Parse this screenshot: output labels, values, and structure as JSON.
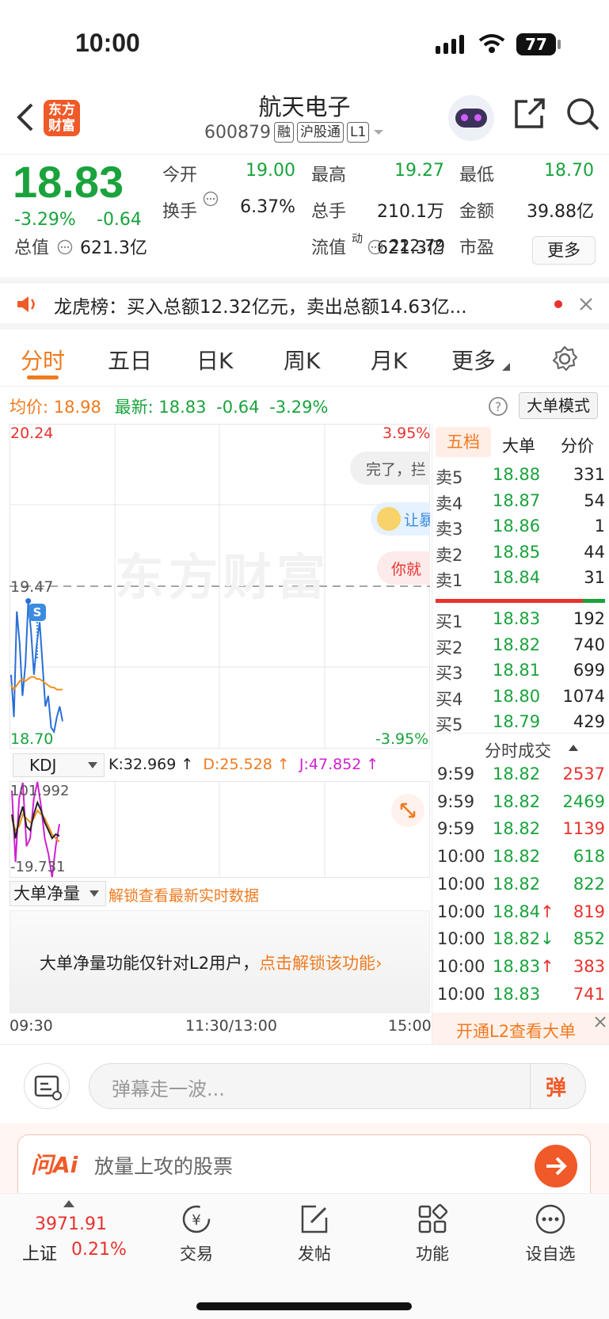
{
  "status": {
    "time": "10:00",
    "battery": "77"
  },
  "header": {
    "brand": "东方财富",
    "title": "航天电子",
    "code": "600879",
    "tags": [
      "融",
      "沪股通",
      "L1"
    ]
  },
  "quote": {
    "price": "18.83",
    "pct": "-3.29%",
    "chg": "-0.64",
    "fields": [
      {
        "label": "今开",
        "value": "19.00",
        "color": "green"
      },
      {
        "label": "最高",
        "value": "19.27",
        "color": "green"
      },
      {
        "label": "最低",
        "value": "18.70",
        "color": "green"
      },
      {
        "label": "换手",
        "value": "6.37%",
        "color": "dark"
      },
      {
        "label": "总手",
        "value": "210.1万",
        "color": "dark"
      },
      {
        "label": "金额",
        "value": "39.88亿",
        "color": "dark"
      },
      {
        "label": "总值",
        "value": "621.3亿",
        "color": "dark"
      },
      {
        "label": "流值",
        "value": "621.3亿",
        "color": "dark"
      },
      {
        "label": "市盈",
        "value": "222.79",
        "color": "dark"
      }
    ],
    "pe_sup": "动",
    "more": "更多"
  },
  "banner": {
    "text": "龙虎榜：买入总额12.32亿元，卖出总额14.63亿..."
  },
  "tabs": [
    "分时",
    "五日",
    "日K",
    "周K",
    "月K",
    "更多"
  ],
  "chart": {
    "avg_label": "均价:",
    "avg": "18.98",
    "latest_label": "最新:",
    "latest": "18.83",
    "chg": "-0.64",
    "pct": "-3.29%",
    "mode": "大单模式",
    "y_max": "20.24",
    "y_mid": "19.47",
    "y_min": "18.70",
    "pct_max": "3.95%",
    "pct_min": "-3.95%",
    "watermark": "东方财富",
    "marker": "S",
    "danmu": [
      "完了，拦",
      "让暴",
      "你就"
    ],
    "kdj": {
      "name": "KDJ",
      "k": "K:32.969 ↑",
      "d": "D:25.528 ↑",
      "j": "J:47.852 ↑",
      "max": "101.992",
      "min": "-19.731"
    },
    "big": {
      "name": "大单净量",
      "unlock": "解锁查看最新实时数据",
      "msg": "大单净量功能仅针对L2用户，",
      "link": "点击解锁该功能"
    },
    "x_labels": [
      "09:30",
      "11:30/13:00",
      "15:00"
    ]
  },
  "chart_data": {
    "type": "line",
    "series": [
      {
        "name": "price",
        "values": [
          19.05,
          18.85,
          19.35,
          19.2,
          18.95,
          19.1,
          19.4,
          19.25,
          19.05,
          19.2,
          19.3,
          19.1,
          18.9,
          18.95,
          18.8,
          18.78,
          18.85,
          18.9,
          18.83
        ]
      },
      {
        "name": "avg",
        "values": [
          19.0,
          18.98,
          19.0,
          19.02,
          19.03,
          19.02,
          19.03,
          19.04,
          19.04,
          19.03,
          19.03,
          19.02,
          19.01,
          19.0,
          18.99,
          18.99,
          18.98,
          18.98,
          18.98
        ]
      }
    ],
    "ylim": [
      18.7,
      20.24
    ],
    "kdj": {
      "K": [
        60,
        30,
        55,
        70,
        45,
        40,
        60,
        75,
        65,
        50,
        40,
        30,
        35,
        32.969
      ],
      "D": [
        55,
        40,
        45,
        60,
        55,
        50,
        55,
        65,
        60,
        55,
        45,
        35,
        30,
        25.528
      ],
      "J": [
        90,
        0,
        80,
        100,
        20,
        30,
        80,
        101,
        70,
        30,
        10,
        -19,
        20,
        47.852
      ],
      "ylim": [
        -19.731,
        101.992
      ]
    }
  },
  "side": {
    "tabs": [
      "五档",
      "大单",
      "分价"
    ],
    "asks": [
      {
        "l": "卖5",
        "p": "18.88",
        "v": "331"
      },
      {
        "l": "卖4",
        "p": "18.87",
        "v": "54"
      },
      {
        "l": "卖3",
        "p": "18.86",
        "v": "1"
      },
      {
        "l": "卖2",
        "p": "18.85",
        "v": "44"
      },
      {
        "l": "卖1",
        "p": "18.84",
        "v": "31"
      }
    ],
    "bids": [
      {
        "l": "买1",
        "p": "18.83",
        "v": "192"
      },
      {
        "l": "买2",
        "p": "18.82",
        "v": "740"
      },
      {
        "l": "买3",
        "p": "18.81",
        "v": "699"
      },
      {
        "l": "买4",
        "p": "18.80",
        "v": "1074"
      },
      {
        "l": "买5",
        "p": "18.79",
        "v": "429"
      }
    ],
    "ticks_title": "分时成交",
    "ticks": [
      {
        "t": "9:59",
        "p": "18.82",
        "v": "2537",
        "c": "red"
      },
      {
        "t": "9:59",
        "p": "18.82",
        "v": "2469",
        "c": "green"
      },
      {
        "t": "9:59",
        "p": "18.82",
        "v": "1139",
        "c": "red"
      },
      {
        "t": "10:00",
        "p": "18.82",
        "v": "618",
        "c": "green"
      },
      {
        "t": "10:00",
        "p": "18.82",
        "v": "822",
        "c": "green"
      },
      {
        "t": "10:00",
        "p": "18.84↑",
        "v": "819",
        "c": "red"
      },
      {
        "t": "10:00",
        "p": "18.82↓",
        "v": "852",
        "c": "green"
      },
      {
        "t": "10:00",
        "p": "18.83↑",
        "v": "383",
        "c": "red"
      },
      {
        "t": "10:00",
        "p": "18.83",
        "v": "741",
        "c": "red"
      }
    ],
    "l2": "开通L2查看大单"
  },
  "chat": {
    "placeholder": "弹幕走一波...",
    "send": "弹"
  },
  "ai": {
    "brand": "问Ai",
    "placeholder": "放量上攻的股票"
  },
  "bottom": {
    "index_val": "3971.91",
    "index_name": "上证",
    "index_pct": "0.21%",
    "items": [
      "交易",
      "发帖",
      "功能",
      "设自选"
    ]
  },
  "colors": {
    "up": "#e8322e",
    "down": "#1aa33c",
    "accent": "#f07a1f",
    "brand": "#f05a28"
  }
}
